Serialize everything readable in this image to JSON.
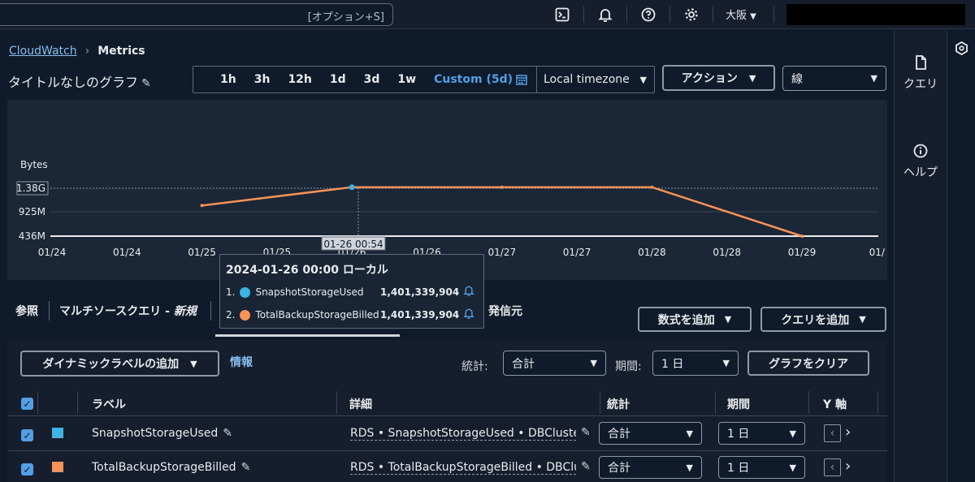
{
  "topbar": {
    "search_shortcut": "[オプション+S]",
    "region": "大阪",
    "icons": [
      "cloudshell-icon",
      "bell-icon",
      "help-icon",
      "gear-icon"
    ]
  },
  "breadcrumb": {
    "root": "CloudWatch",
    "current": "Metrics"
  },
  "graph": {
    "title": "タイトルなしのグラフ"
  },
  "time_range": {
    "options": [
      "1h",
      "3h",
      "12h",
      "1d",
      "3d",
      "1w"
    ],
    "custom": "Custom (5d)",
    "timezone": "Local timezone"
  },
  "toolbar": {
    "actions_label": "アクション",
    "graph_type": "線"
  },
  "chart_data": {
    "type": "line",
    "ylabel": "Bytes",
    "y_ticks": [
      "436M",
      "925M",
      "1.38G"
    ],
    "x_ticks": [
      "01/24",
      "01/24",
      "01/25",
      "01/25",
      "01/26",
      "01/26",
      "01/27",
      "01/27",
      "01/28",
      "01/28",
      "01/29",
      "01/"
    ],
    "hover_x_label": "01-26 00:54",
    "series": [
      {
        "name": "TotalBackupStorageBilled",
        "color": "#f89256",
        "x": [
          "2024-01-25",
          "2024-01-26",
          "2024-01-27",
          "2024-01-28",
          "2024-01-29"
        ],
        "y": [
          1.04,
          1.401,
          1.401,
          1.401,
          0.436
        ]
      },
      {
        "name": "SnapshotStorageUsed",
        "color": "#3cb4e5",
        "x": [
          "2024-01-26"
        ],
        "y": [
          1.401
        ]
      }
    ]
  },
  "tooltip": {
    "title": "2024-01-26 00:00 ローカル",
    "rows": [
      {
        "index": "1.",
        "name": "SnapshotStorageUsed",
        "value": "1,401,339,904",
        "color": "#3cb4e5"
      },
      {
        "index": "2.",
        "name": "TotalBackupStorageBilled",
        "value": "1,401,339,904",
        "color": "#f89256"
      }
    ]
  },
  "tabs": {
    "browse": "参照",
    "multisource": "マルチソースクエリ - ",
    "multisource_em": "新規",
    "source": "発信元"
  },
  "query_buttons": {
    "add_math": "数式を追加",
    "add_query": "クエリを追加"
  },
  "controls": {
    "dynamic_label": "ダイナミックラベルの追加",
    "info": "情報",
    "stat_label": "統計:",
    "stat_value": "合計",
    "period_label": "期間:",
    "period_value": "1 日",
    "clear_graph": "グラフをクリア"
  },
  "table": {
    "headers": {
      "label": "ラベル",
      "details": "詳細",
      "stat": "統計",
      "period": "期間",
      "yaxis": "Y 軸"
    },
    "rows": [
      {
        "label": "SnapshotStorageUsed",
        "details": "RDS • SnapshotStorageUsed • DBClusterIdentifier",
        "stat": "合計",
        "period": "1 日",
        "color": "#3cb4e5"
      },
      {
        "label": "TotalBackupStorageBilled",
        "details": "RDS • TotalBackupStorageBilled • DBClusterIdentifier",
        "stat": "合計",
        "period": "1 日",
        "color": "#f89256"
      }
    ]
  },
  "rail": {
    "query": "クエリ",
    "help": "ヘルプ"
  }
}
